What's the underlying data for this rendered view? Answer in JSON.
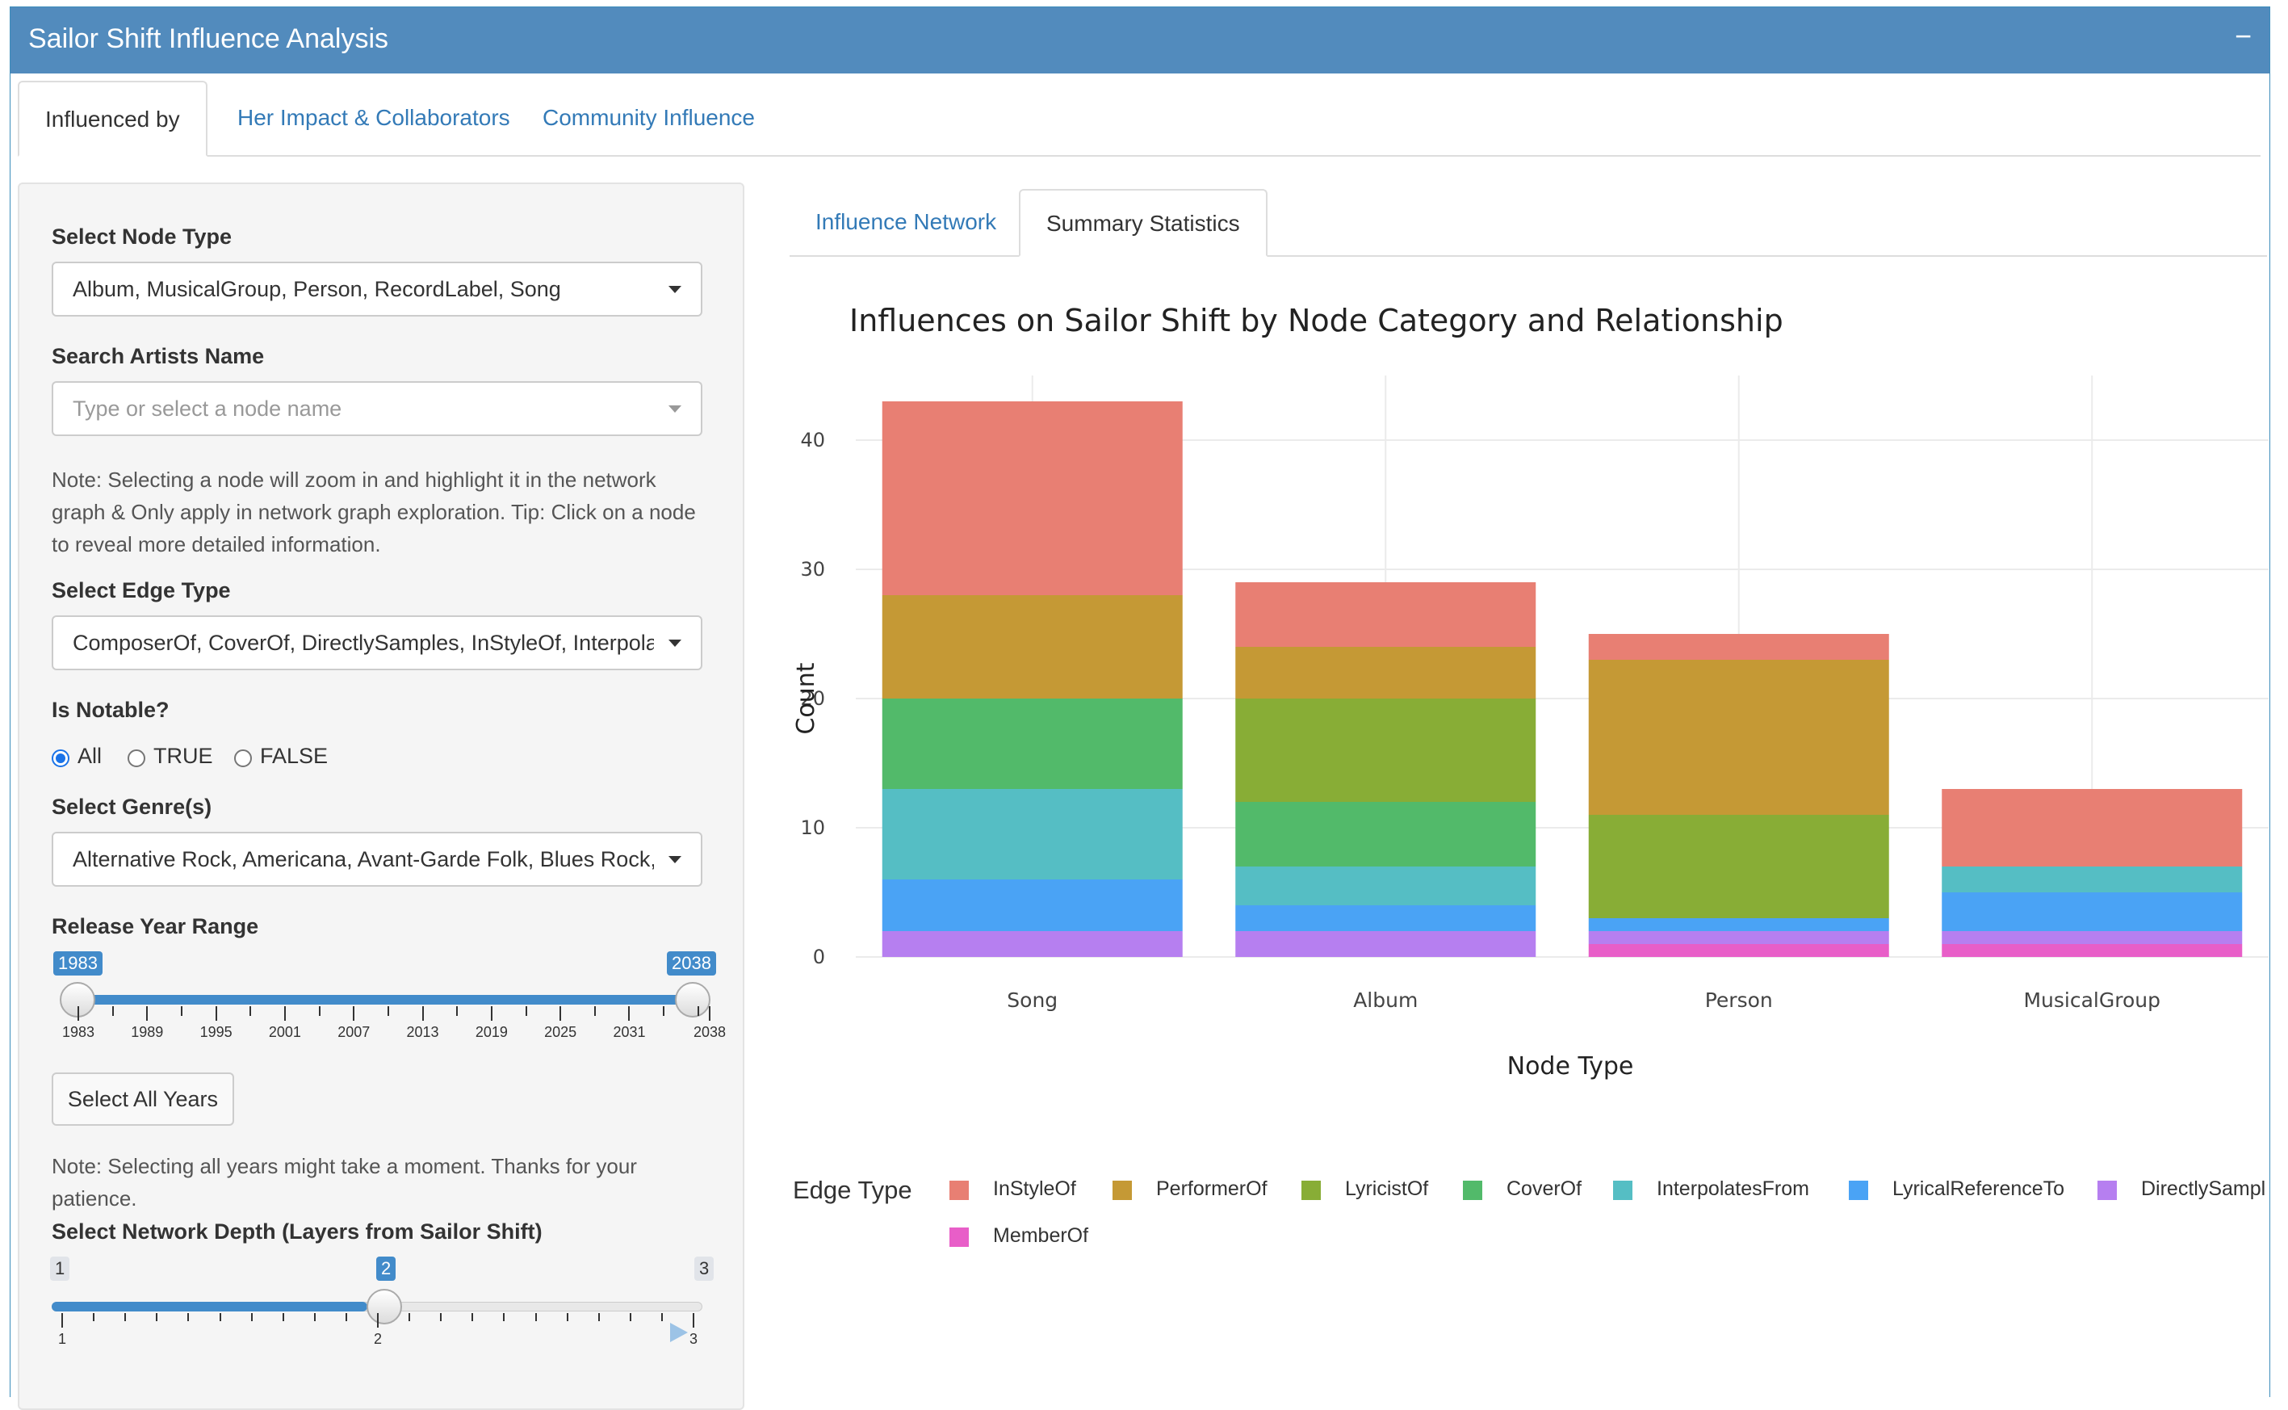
{
  "header": {
    "title": "Sailor Shift Influence Analysis",
    "collapse_symbol": "−"
  },
  "main_tabs": [
    {
      "label": "Influenced by",
      "active": true
    },
    {
      "label": "Her Impact & Collaborators",
      "active": false
    },
    {
      "label": "Community Influence",
      "active": false
    }
  ],
  "sidebar": {
    "node_type": {
      "label": "Select Node Type",
      "value": "Album, MusicalGroup, Person, RecordLabel, Song"
    },
    "search": {
      "label": "Search Artists Name",
      "placeholder": "Type or select a node name"
    },
    "note1": "Note: Selecting a node will zoom in and highlight it in the network graph & Only apply in network graph exploration. Tip: Click on a node to reveal more detailed information.",
    "edge_type": {
      "label": "Select Edge Type",
      "value": "ComposerOf, CoverOf, DirectlySamples, InStyleOf, Interpolates"
    },
    "notable": {
      "label": "Is Notable?",
      "options": [
        "All",
        "TRUE",
        "FALSE"
      ],
      "selected": "All"
    },
    "genre": {
      "label": "Select Genre(s)",
      "value": "Alternative Rock, Americana, Avant-Garde Folk, Blues Rock, Do"
    },
    "year_range": {
      "label": "Release Year Range",
      "min": 1983,
      "max": 2038,
      "from": 1983,
      "to": 2038,
      "from_label": "1983",
      "to_label": "2038",
      "tick_labels": [
        "1983",
        "1989",
        "1995",
        "2001",
        "2007",
        "2013",
        "2019",
        "2025",
        "2031",
        "2038"
      ]
    },
    "select_all_button": "Select All Years",
    "note2": "Note: Selecting all years might take a moment. Thanks for your patience.",
    "depth": {
      "label": "Select Network Depth (Layers from Sailor Shift)",
      "min": 1,
      "max": 3,
      "value": 2,
      "min_label": "1",
      "max_label": "3",
      "value_label": "2",
      "tick_labels": [
        "1",
        "2",
        "3"
      ]
    }
  },
  "sub_tabs": [
    {
      "label": "Influence Network",
      "active": false
    },
    {
      "label": "Summary Statistics",
      "active": true
    }
  ],
  "chart_data": {
    "type": "bar",
    "stacked": true,
    "title": "Influences on Sailor Shift by Node Category and Relationship",
    "xlabel": "Node Type",
    "ylabel": "Count",
    "ylim": [
      0,
      45
    ],
    "yticks": [
      0,
      10,
      20,
      30,
      40
    ],
    "grid": true,
    "legend_position": "bottom",
    "legend_title": "Edge Type",
    "categories": [
      "Song",
      "Album",
      "Person",
      "MusicalGroup"
    ],
    "series": [
      {
        "name": "MemberOf",
        "color": "#e85ec8",
        "values": [
          0,
          0,
          1,
          1
        ]
      },
      {
        "name": "DirectlySampl",
        "color": "#b67ff0",
        "values": [
          2,
          2,
          1,
          1
        ]
      },
      {
        "name": "LyricalReferenceTo",
        "color": "#4aa3f5",
        "values": [
          4,
          2,
          1,
          3
        ]
      },
      {
        "name": "InterpolatesFrom",
        "color": "#55bec4",
        "values": [
          7,
          3,
          0,
          2
        ]
      },
      {
        "name": "CoverOf",
        "color": "#52ba6a",
        "values": [
          7,
          5,
          0,
          0
        ]
      },
      {
        "name": "LyricistOf",
        "color": "#88ad36",
        "values": [
          0,
          8,
          8,
          0
        ]
      },
      {
        "name": "PerformerOf",
        "color": "#c59935",
        "values": [
          8,
          4,
          12,
          0
        ]
      },
      {
        "name": "InStyleOf",
        "color": "#e87f73",
        "values": [
          15,
          5,
          2,
          6
        ]
      }
    ],
    "legend_order": [
      "InStyleOf",
      "PerformerOf",
      "LyricistOf",
      "CoverOf",
      "InterpolatesFrom",
      "LyricalReferenceTo",
      "DirectlySampl",
      "MemberOf"
    ]
  }
}
